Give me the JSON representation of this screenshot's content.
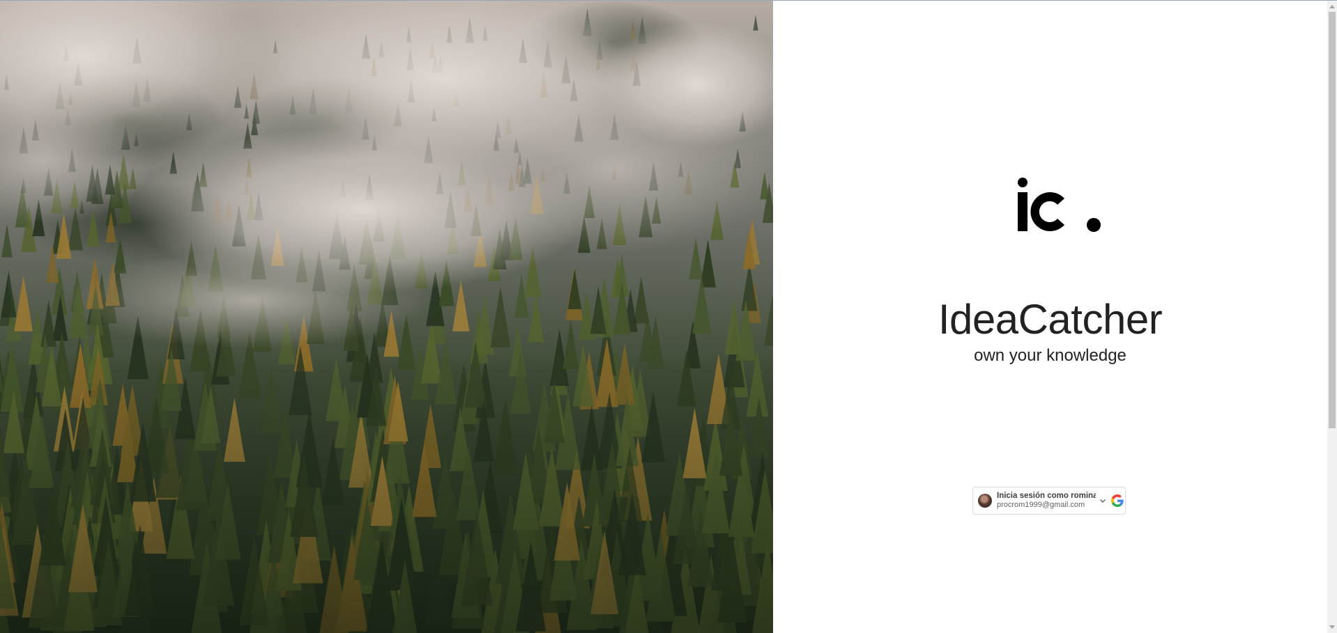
{
  "hero": {
    "image_alt": "Foggy pine forest",
    "image_description": "Aerial view of evergreen and larch forest with thick mist"
  },
  "brand": {
    "logo_text": "ic.",
    "title": "IdeaCatcher",
    "tagline": "own your knowledge"
  },
  "google_signin": {
    "primary_text": "Inicia sesión como romina",
    "email": "procrom1999@gmail.com",
    "icons": [
      "avatar",
      "chevron-down-icon",
      "google-g-icon"
    ]
  },
  "colors": {
    "title_text": "#222222",
    "logo": "#000000",
    "google_blue": "#4285F4",
    "google_red": "#EA4335",
    "google_yellow": "#FBBC05",
    "google_green": "#34A853"
  }
}
